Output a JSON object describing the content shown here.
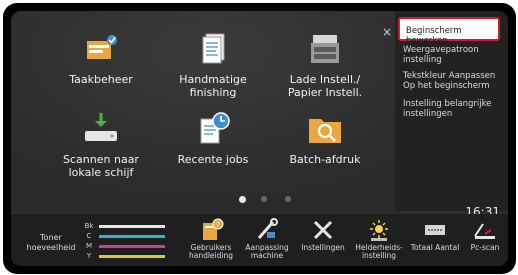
{
  "apps": [
    {
      "label": "Taakbeheer",
      "icon": "job-status-icon"
    },
    {
      "label": "Handmatige\nfinishing",
      "icon": "manual-finishing-icon"
    },
    {
      "label": "Lade Instell./\nPapier Instell.",
      "icon": "tray-settings-icon"
    },
    {
      "label": "Scannen naar\nlokale schijf",
      "icon": "scan-to-local-drive-icon"
    },
    {
      "label": "Recente jobs",
      "icon": "recent-jobs-icon"
    },
    {
      "label": "Batch-afdruk",
      "icon": "batch-print-icon"
    }
  ],
  "pagination": {
    "pages": 3,
    "current": 1
  },
  "clock": "16:31",
  "close_label": "×",
  "menu": {
    "items": [
      "Beginscherm bewerken",
      "Weergavepatroon instelling",
      "Tekstkleur Aanpassen Op het beginscherm",
      "Instelling belangrijke instellingen"
    ],
    "selected_index": 0,
    "highlight_color": "#d01d35"
  },
  "toner": {
    "label": "Toner hoeveelheid",
    "colors": [
      {
        "name": "Bk",
        "hex": "#e8e8e8",
        "level": 1.0
      },
      {
        "name": "C",
        "hex": "#2ab4d6",
        "level": 1.0
      },
      {
        "name": "M",
        "hex": "#c83ea0",
        "level": 1.0
      },
      {
        "name": "Y",
        "hex": "#d8c732",
        "level": 1.0
      }
    ]
  },
  "dock": [
    {
      "label": "Gebruikers handleiding",
      "icon": "user-manual-icon"
    },
    {
      "label": "Aanpassing machine",
      "icon": "machine-adjustment-icon"
    },
    {
      "label": "Instellingen",
      "icon": "settings-tools-icon"
    },
    {
      "label": "Helderheids- instelling",
      "icon": "brightness-icon"
    },
    {
      "label": "Totaal Aantal",
      "icon": "total-count-icon"
    },
    {
      "label": "Pc-scan",
      "icon": "pc-scan-icon"
    }
  ]
}
